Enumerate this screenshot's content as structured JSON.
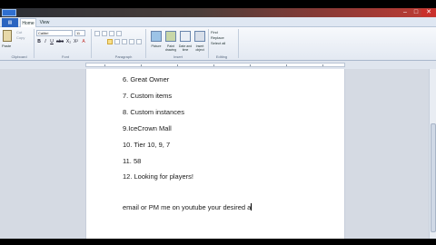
{
  "window": {
    "title_bar_color": "#c03b34"
  },
  "tabs": [
    {
      "label": "Home",
      "active": true
    },
    {
      "label": "View",
      "active": false
    }
  ],
  "ribbon": {
    "clipboard": {
      "paste_label": "Paste",
      "cut_label": "Cut",
      "copy_label": "Copy",
      "group_label": "Clipboard"
    },
    "font": {
      "font_name": "Calibri",
      "font_size": "11",
      "group_label": "Font",
      "format_buttons": [
        "B",
        "I",
        "U",
        "abc",
        "X₂",
        "X²",
        "A"
      ]
    },
    "paragraph": {
      "group_label": "Paragraph"
    },
    "insert": {
      "group_label": "Insert",
      "items": [
        "Picture",
        "Paint drawing",
        "Date and time",
        "Insert object"
      ]
    },
    "editing": {
      "group_label": "Editing",
      "items": [
        "Find",
        "Replace",
        "Select all"
      ]
    }
  },
  "document": {
    "lines": [
      "6. Great Owner",
      "7. Custom items",
      "8. Custom instances",
      "9.IceCrown Mall",
      "10. Tier 10, 9, 7",
      "11. 58",
      "12. Looking for players!",
      "email or PM me on youtube your desired a"
    ]
  }
}
